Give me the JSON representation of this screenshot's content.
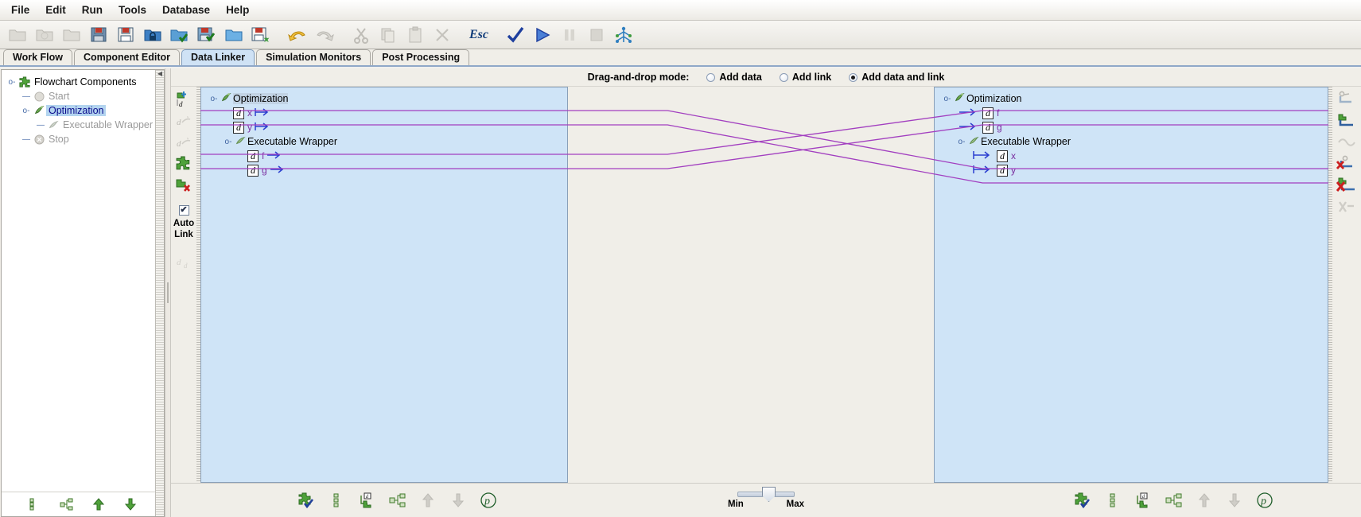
{
  "menu": {
    "items": [
      "File",
      "Edit",
      "Run",
      "Tools",
      "Database",
      "Help"
    ]
  },
  "toolbar": {
    "buttons": [
      {
        "name": "new-icon",
        "glyph": "folder-grey",
        "enabled": false
      },
      {
        "name": "open-recent-icon",
        "glyph": "folder-grey2",
        "enabled": false
      },
      {
        "name": "open-folder-icon",
        "glyph": "folder-grey3",
        "enabled": false
      },
      {
        "name": "save-icon",
        "glyph": "floppy-blue",
        "enabled": true
      },
      {
        "name": "save-as-icon",
        "glyph": "floppy-white",
        "enabled": true
      },
      {
        "name": "lock-icon",
        "glyph": "folder-lock",
        "enabled": true
      },
      {
        "name": "open-check-icon",
        "glyph": "folder-check",
        "enabled": true
      },
      {
        "name": "save-check-icon",
        "glyph": "floppy-check",
        "enabled": true
      },
      {
        "name": "open-blue-icon",
        "glyph": "folder-blue",
        "enabled": true
      },
      {
        "name": "save-new-icon",
        "glyph": "floppy-star",
        "enabled": true
      },
      {
        "name": "undo-icon",
        "glyph": "arrow-undo",
        "enabled": true
      },
      {
        "name": "redo-icon",
        "glyph": "arrow-redo",
        "enabled": false
      },
      {
        "name": "cut-icon",
        "glyph": "scissors",
        "enabled": false
      },
      {
        "name": "copy-icon",
        "glyph": "copy",
        "enabled": false
      },
      {
        "name": "paste-icon",
        "glyph": "clipboard",
        "enabled": false
      },
      {
        "name": "delete-icon",
        "glyph": "x-cross",
        "enabled": false
      },
      {
        "name": "escape-button",
        "glyph": "esc-text",
        "enabled": true
      },
      {
        "name": "validate-icon",
        "glyph": "check-blue",
        "enabled": true
      },
      {
        "name": "run-icon",
        "glyph": "play-blue",
        "enabled": true
      },
      {
        "name": "pause-icon",
        "glyph": "pause",
        "enabled": false
      },
      {
        "name": "stop-icon",
        "glyph": "stop-square",
        "enabled": false
      },
      {
        "name": "parallel-icon",
        "glyph": "network-blue",
        "enabled": true
      }
    ],
    "esc_label": "Esc"
  },
  "tabs": {
    "items": [
      "Work Flow",
      "Component Editor",
      "Data Linker",
      "Simulation Monitors",
      "Post Processing"
    ],
    "active": "Data Linker"
  },
  "sidebar": {
    "tree": [
      {
        "label": "Flowchart Components",
        "level": 0,
        "icon": "puzzle-green-icon",
        "state": "normal",
        "expander": "expanded"
      },
      {
        "label": "Start",
        "level": 1,
        "icon": "circle-grey-icon",
        "state": "dim",
        "expander": "none"
      },
      {
        "label": "Optimization",
        "level": 1,
        "icon": "optimization-green-icon",
        "state": "selected",
        "expander": "expanded"
      },
      {
        "label": "Executable Wrapper",
        "level": 2,
        "icon": "wrapper-grey-icon",
        "state": "dim",
        "expander": "none"
      },
      {
        "label": "Stop",
        "level": 1,
        "icon": "circle-x-grey-icon",
        "state": "dim",
        "expander": "none"
      }
    ],
    "bottom_buttons": [
      {
        "name": "component-list-icon"
      },
      {
        "name": "component-tree-icon"
      },
      {
        "name": "move-up-icon"
      },
      {
        "name": "move-down-icon"
      }
    ]
  },
  "linker": {
    "mode_label": "Drag-and-drop mode:",
    "modes": [
      {
        "label": "Add data",
        "selected": false
      },
      {
        "label": "Add link",
        "selected": false
      },
      {
        "label": "Add data and link",
        "selected": true
      }
    ],
    "auto_link": {
      "line1": "Auto",
      "line2": "Link",
      "checked": true
    },
    "left_strip_buttons": [
      {
        "name": "add-data-icon",
        "enabled": true
      },
      {
        "name": "edit-data-icon",
        "enabled": false
      },
      {
        "name": "copy-data-icon",
        "enabled": false
      },
      {
        "name": "add-component-icon",
        "enabled": true
      },
      {
        "name": "remove-data-icon",
        "enabled": false
      }
    ],
    "right_strip_buttons": [
      {
        "name": "link-icon",
        "enabled": false
      },
      {
        "name": "add-link-icon",
        "enabled": true
      },
      {
        "name": "auto-link-icon",
        "enabled": false
      },
      {
        "name": "delete-link-icon",
        "enabled": true
      },
      {
        "name": "delete-all-links-icon",
        "enabled": true
      },
      {
        "name": "broken-link-icon",
        "enabled": false
      }
    ],
    "source_tree": [
      {
        "type": "component",
        "label": "Optimization",
        "level": 0,
        "highlight": true,
        "expander": "expanded"
      },
      {
        "type": "data",
        "label": "x",
        "level": 1,
        "port": "out"
      },
      {
        "type": "data",
        "label": "y",
        "level": 1,
        "port": "out"
      },
      {
        "type": "component",
        "label": "Executable Wrapper",
        "level": 1,
        "highlight": false,
        "expander": "expanded"
      },
      {
        "type": "data",
        "label": "f",
        "level": 2,
        "port": "out"
      },
      {
        "type": "data",
        "label": "g",
        "level": 2,
        "port": "out"
      }
    ],
    "target_tree": [
      {
        "type": "component",
        "label": "Optimization",
        "level": 0,
        "highlight": false,
        "expander": "expanded"
      },
      {
        "type": "data",
        "label": "f",
        "level": 1,
        "port": "in"
      },
      {
        "type": "data",
        "label": "g",
        "level": 1,
        "port": "in"
      },
      {
        "type": "component",
        "label": "Executable Wrapper",
        "level": 1,
        "highlight": false,
        "expander": "expanded"
      },
      {
        "type": "data",
        "label": "x",
        "level": 2,
        "port": "in"
      },
      {
        "type": "data",
        "label": "y",
        "level": 2,
        "port": "in"
      }
    ],
    "links": [
      {
        "from": "x",
        "to": "x"
      },
      {
        "from": "y",
        "to": "y"
      },
      {
        "from": "f",
        "to": "f"
      },
      {
        "from": "g",
        "to": "g"
      }
    ],
    "link_color": "#a23fc0",
    "slider": {
      "min_label": "Min",
      "max_label": "Max",
      "value": 50
    },
    "bottom_left_buttons": [
      {
        "name": "select-component-icon"
      },
      {
        "name": "list-view-icon"
      },
      {
        "name": "add-data-tree-icon"
      },
      {
        "name": "expand-tree-icon"
      },
      {
        "name": "move-up-icon",
        "enabled": false
      },
      {
        "name": "move-down-icon",
        "enabled": false
      },
      {
        "name": "properties-icon"
      }
    ],
    "bottom_right_buttons": [
      {
        "name": "select-component-icon"
      },
      {
        "name": "list-view-icon"
      },
      {
        "name": "add-data-tree-icon"
      },
      {
        "name": "expand-tree-icon"
      },
      {
        "name": "move-up-icon",
        "enabled": false
      },
      {
        "name": "move-down-icon",
        "enabled": false
      },
      {
        "name": "properties-icon"
      }
    ]
  },
  "colors": {
    "tab_active": "#cfe2f5",
    "pane_bg": "#cfe4f7",
    "link": "#a23fc0",
    "arrow": "#2b3fd0",
    "selected_tree": "#b3d4ef"
  }
}
